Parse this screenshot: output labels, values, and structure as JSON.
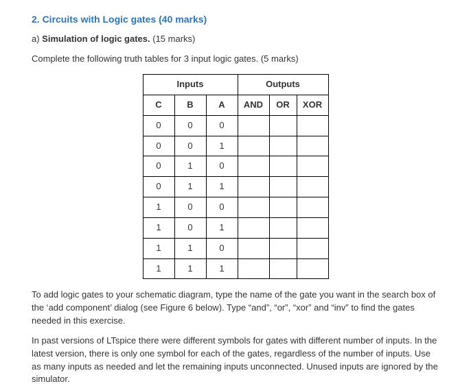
{
  "heading": "2. Circuits with Logic gates (40 marks)",
  "subsection_letter": "a)  ",
  "subsection_bold": "Simulation of logic gates.",
  "subsection_tail": " (15 marks)",
  "instruction": "Complete the following truth tables for 3 input logic gates. (5 marks)",
  "table": {
    "group_inputs": "Inputs",
    "group_outputs": "Outputs",
    "headers": {
      "c": "C",
      "b": "B",
      "a": "A",
      "and": "AND",
      "or": "OR",
      "xor": "XOR"
    },
    "rows": [
      {
        "c": "0",
        "b": "0",
        "a": "0",
        "and": "",
        "or": "",
        "xor": ""
      },
      {
        "c": "0",
        "b": "0",
        "a": "1",
        "and": "",
        "or": "",
        "xor": ""
      },
      {
        "c": "0",
        "b": "1",
        "a": "0",
        "and": "",
        "or": "",
        "xor": ""
      },
      {
        "c": "0",
        "b": "1",
        "a": "1",
        "and": "",
        "or": "",
        "xor": ""
      },
      {
        "c": "1",
        "b": "0",
        "a": "0",
        "and": "",
        "or": "",
        "xor": ""
      },
      {
        "c": "1",
        "b": "0",
        "a": "1",
        "and": "",
        "or": "",
        "xor": ""
      },
      {
        "c": "1",
        "b": "1",
        "a": "0",
        "and": "",
        "or": "",
        "xor": ""
      },
      {
        "c": "1",
        "b": "1",
        "a": "1",
        "and": "",
        "or": "",
        "xor": ""
      }
    ]
  },
  "para1": "To add logic gates to your schematic diagram, type the name of the gate you want in the search box of the ‘add component’ dialog (see Figure 6 below). Type “and”, “or”, “xor” and “inv” to find the gates needed in this exercise.",
  "para2": "In past versions of LTspice there were different symbols for gates with different number of inputs. In the latest version, there is only one symbol for each of the gates, regardless of the number of inputs. Use as many inputs as needed and let the remaining inputs unconnected. Unused inputs are ignored by the simulator."
}
